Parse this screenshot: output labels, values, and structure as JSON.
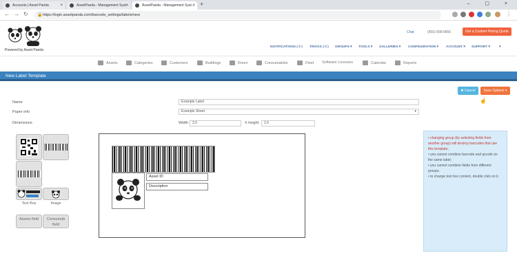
{
  "browser": {
    "tabs": [
      {
        "title": "Accounts | Asset Panda"
      },
      {
        "title": "AssetPanda - Management Syst..."
      },
      {
        "title": "AssetPanda - Management Syst..."
      }
    ],
    "url": "https://login.assetpanda.com/barcode_settings/labels/new"
  },
  "header": {
    "powered_by": "Powered by Asset Panda",
    "chat": "Chat",
    "phone": "(855) 898-8856",
    "quote_button": "Get a Custom Pricing Quote",
    "nav": [
      "NOTIFICATIONS ( 0 )",
      "TRICKS ( 0 )",
      "GROUPS ▾",
      "TOOLS ▾",
      "GALLERIES ▾",
      "CONFIGURATION ▾",
      "ACCOUNT ▾",
      "SUPPORT ▾",
      "▾"
    ]
  },
  "menu": [
    "Assets",
    "Categories",
    "Customers",
    "Buildings",
    "Room",
    "Consumables",
    "Fleet",
    "Software Licenses",
    "Calendar",
    "Reports"
  ],
  "page": {
    "title": "New Label Template",
    "cancel_label": "✖ Cancel",
    "save_label": "Save Options ▾"
  },
  "form": {
    "name_label": "Name",
    "name_value": "Example Label",
    "paper_label": "Paper info",
    "paper_value": "Example Sheet",
    "dimensions_label": "Dimensions",
    "width_label": "Width",
    "width_value": "2.0",
    "height_label": "X height",
    "height_value": "1.0"
  },
  "tools": {
    "text_box": "Text Box",
    "image": "Image",
    "assets_field": "Assets field",
    "consumables_field": "Consumab field"
  },
  "canvas": {
    "field1": "Asset ID",
    "field2": "Description"
  },
  "info": [
    "changing group (by selecting fields from another group) will destroy barcodes that use this template;",
    "you cannot combine barcode and qrcode on the same label;",
    "you cannot combine fields from different groups;",
    "to change text box content, double click on it."
  ],
  "colors": {
    "title_bar": "#3a82c0",
    "cancel": "#54b5e0",
    "save": "#f0733c",
    "quote": "#f0633c",
    "info_bg": "#d8ecfa"
  }
}
